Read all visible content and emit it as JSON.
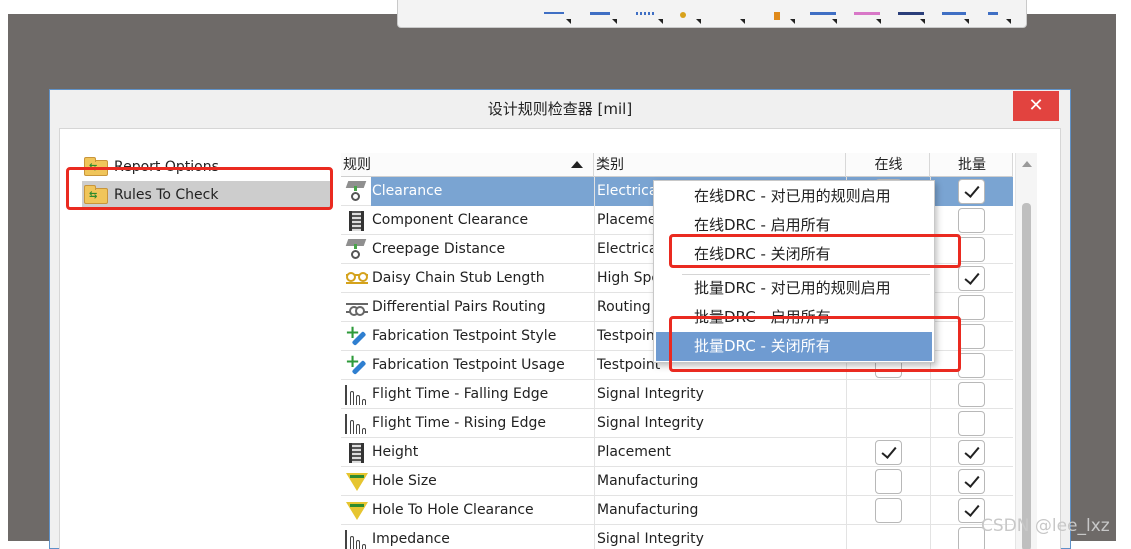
{
  "dialog": {
    "title": "设计规则检查器 [mil]",
    "close_glyph": "✕"
  },
  "tree": {
    "items": [
      {
        "label": "Report Options",
        "selected": false
      },
      {
        "label": "Rules To Check",
        "selected": true
      }
    ]
  },
  "grid": {
    "columns": {
      "rule": "规则",
      "category": "类别",
      "online": "在线",
      "batch": "批量"
    },
    "sort_column": "rule",
    "sort_direction": "ascending",
    "rows": [
      {
        "name": "Clearance",
        "category": "Electrical",
        "icon": "clearance-icon",
        "online": true,
        "batch": true,
        "selected": true
      },
      {
        "name": "Component Clearance",
        "category": "Placement",
        "icon": "component-icon",
        "online": false,
        "batch": false
      },
      {
        "name": "Creepage Distance",
        "category": "Electrical",
        "icon": "clearance-icon",
        "online": false,
        "batch": false
      },
      {
        "name": "Daisy Chain Stub Length",
        "category": "High Speed",
        "icon": "daisy-chain-icon",
        "online": false,
        "batch": true
      },
      {
        "name": "Differential Pairs Routing",
        "category": "Routing",
        "icon": "diff-pair-icon",
        "online": false,
        "batch": false
      },
      {
        "name": "Fabrication Testpoint Style",
        "category": "Testpoint",
        "icon": "testpoint-icon",
        "online": false,
        "batch": false
      },
      {
        "name": "Fabrication Testpoint Usage",
        "category": "Testpoint",
        "icon": "testpoint-icon",
        "online": false,
        "batch": false
      },
      {
        "name": "Flight Time - Falling Edge",
        "category": "Signal Integrity",
        "icon": "signal-wave-icon",
        "online": null,
        "batch": false
      },
      {
        "name": "Flight Time - Rising Edge",
        "category": "Signal Integrity",
        "icon": "signal-wave-icon",
        "online": null,
        "batch": false
      },
      {
        "name": "Height",
        "category": "Placement",
        "icon": "component-icon",
        "online": true,
        "batch": true
      },
      {
        "name": "Hole Size",
        "category": "Manufacturing",
        "icon": "hole-icon",
        "online": false,
        "batch": true
      },
      {
        "name": "Hole To Hole Clearance",
        "category": "Manufacturing",
        "icon": "hole-icon",
        "online": false,
        "batch": true
      },
      {
        "name": "Impedance",
        "category": "Signal Integrity",
        "icon": "signal-wave-icon",
        "online": null,
        "batch": false
      }
    ]
  },
  "context_menu": {
    "items": [
      {
        "label": "在线DRC - 对已用的规则启用",
        "highlighted": false
      },
      {
        "label": "在线DRC - 启用所有",
        "highlighted": false
      },
      {
        "label": "在线DRC - 关闭所有",
        "highlighted": false
      },
      {
        "label": "批量DRC - 对已用的规则启用",
        "highlighted": false
      },
      {
        "label": "批量DRC - 启用所有",
        "highlighted": false
      },
      {
        "label": "批量DRC - 关闭所有",
        "highlighted": true
      }
    ]
  },
  "colors": {
    "selection": "#7aa4d2",
    "menu_highlight": "#6f9bd1",
    "annotation_red": "#ea2a20",
    "close_button": "#e2433f"
  },
  "watermark": "CSDN @lee_lxz"
}
